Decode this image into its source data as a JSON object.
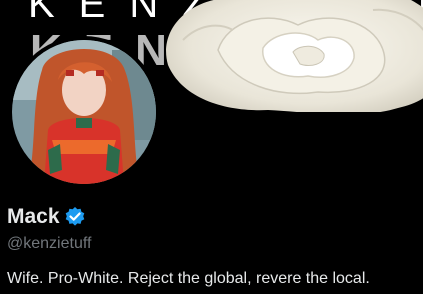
{
  "banner": {
    "text_line_1": "KENZIETUFF",
    "text_line_2": "KENZ"
  },
  "profile": {
    "display_name": "Mack",
    "verified_icon": "verified-badge-icon",
    "handle": "@kenzietuff",
    "bio": "Wife. Pro-White. Reject the global, revere the local."
  },
  "colors": {
    "background": "#000000",
    "primary_text": "#e7e9ea",
    "secondary_text": "#71767b",
    "verified_blue": "#1d9bf0"
  }
}
